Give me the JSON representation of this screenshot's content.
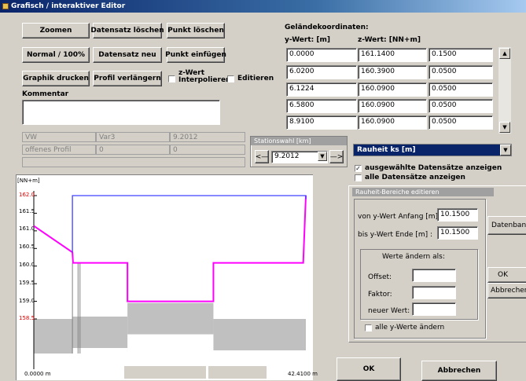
{
  "window": {
    "title": "Grafisch / interaktiver Editor"
  },
  "toolbar": {
    "zoomen": "Zoomen",
    "datensatz_loeschen": "Datensatz löschen",
    "punkt_loeschen": "Punkt löschen",
    "normal_100": "Normal / 100%",
    "datensatz_neu": "Datensatz neu",
    "punkt_einfuegen": "Punkt einfügen",
    "graphik_drucken": "Graphik drucken",
    "profil_verlaengern": "Profil verlängern",
    "z_wert_interpolieren": "z-Wert Interpolieren",
    "editieren": "Editieren"
  },
  "kommentar": {
    "label": "Kommentar",
    "value": ""
  },
  "info": {
    "row1": [
      "VW",
      "Var3",
      "9.2012"
    ],
    "row2": [
      "offenes Profil",
      "0",
      "0"
    ],
    "row3": ""
  },
  "stationswahl": {
    "label": "Stationswahl [km]",
    "value": "9.2012",
    "prev": "<—",
    "next": "—>"
  },
  "gelaende": {
    "title": "Geländekoordinaten:",
    "col_y": "y-Wert: [m]",
    "col_z": "z-Wert: [NN+m]",
    "rows": [
      [
        "0.0000",
        "161.1400",
        "0.1500"
      ],
      [
        "6.0200",
        "160.3900",
        "0.0500"
      ],
      [
        "6.1224",
        "160.0900",
        "0.0500"
      ],
      [
        "6.5800",
        "160.0900",
        "0.0500"
      ],
      [
        "8.9100",
        "160.0900",
        "0.0500"
      ]
    ]
  },
  "rauheit_select": {
    "value": "Rauheit ks [m]"
  },
  "checks": {
    "ausgewaehlte": "ausgewählte Datensätze anzeigen",
    "alle": "alle Datensätze anzeigen"
  },
  "rauheit_panel": {
    "title": "Rauheit-Bereiche editieren",
    "von_label": "von y-Wert Anfang [m] :",
    "von_value": "10.1500",
    "bis_label": "bis  y-Wert Ende [m] :",
    "bis_value": "10.1500",
    "datenbank": "Datenbank",
    "werte_label": "Werte ändern als:",
    "offset": "Offset:",
    "faktor": "Faktor:",
    "neuer_wert": "neuer Wert:",
    "ok": "OK",
    "abbrechen": "Abbrechen",
    "alle_y": "alle y-Werte ändern"
  },
  "footer": {
    "ok": "OK",
    "abbrechen": "Abbrechen"
  },
  "chart_data": {
    "type": "line",
    "title": "",
    "ylabel": "[NN+m]",
    "y_ticks": [
      "162.0",
      "161.5",
      "161.0",
      "160.5",
      "160.0",
      "159.5",
      "159.0",
      "158.5"
    ],
    "x_ticks": [
      "0.0000 m",
      "42.4100 m"
    ],
    "xlim": [
      0,
      42.41
    ],
    "ylim": [
      158.5,
      162.0
    ],
    "series": [
      {
        "color": "#ff00ff",
        "x": [
          0,
          6.02,
          6.12,
          14.6,
          14.6,
          28.0,
          28.0,
          42.0,
          42.41
        ],
        "y": [
          161.14,
          160.39,
          160.09,
          160.09,
          159.0,
          159.0,
          160.09,
          160.09,
          162.0
        ]
      },
      {
        "color": "#4040ff",
        "x": [
          6.02,
          6.02,
          42.41,
          42.41
        ],
        "y": [
          160.39,
          162.0,
          162.0,
          161.9
        ]
      }
    ],
    "grey_fill": {
      "color": "#c0c0c0"
    }
  }
}
